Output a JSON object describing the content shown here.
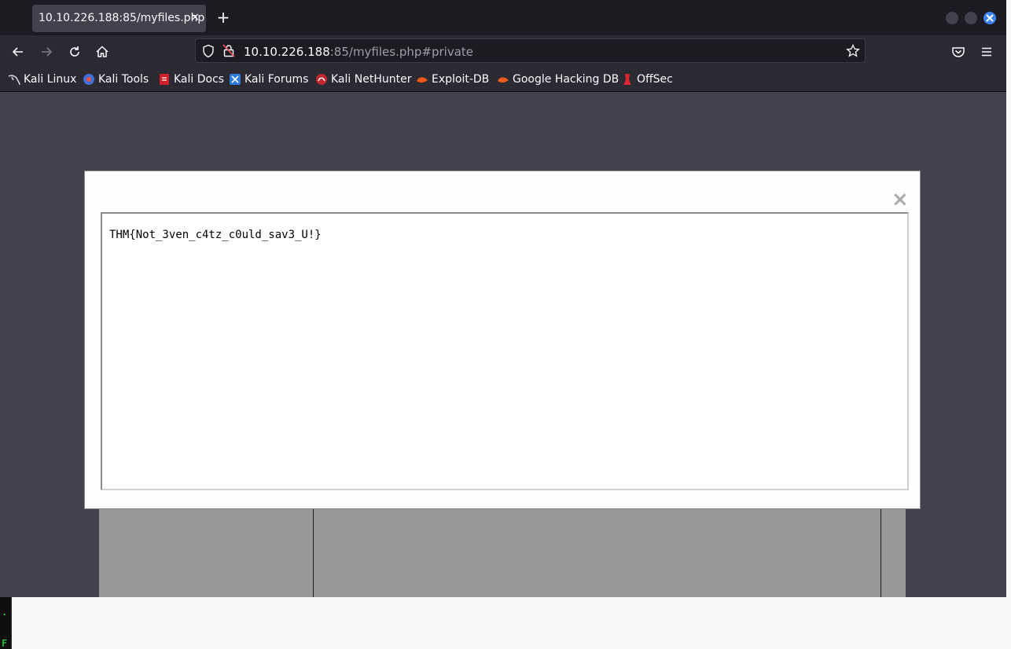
{
  "browser": {
    "tab": {
      "title": "10.10.226.188:85/myfiles.php",
      "close_glyph": "×"
    },
    "new_tab_glyph": "+",
    "url": {
      "host": "10.10.226.188",
      "rest": ":85/myfiles.php#private"
    }
  },
  "bookmarks": [
    {
      "label": "Kali Linux",
      "icon": "kali-dragon-icon"
    },
    {
      "label": "Kali Tools",
      "icon": "kali-tools-icon"
    },
    {
      "label": "Kali Docs",
      "icon": "kali-docs-icon"
    },
    {
      "label": "Kali Forums",
      "icon": "kali-forums-icon"
    },
    {
      "label": "Kali NetHunter",
      "icon": "nethunter-icon"
    },
    {
      "label": "Exploit-DB",
      "icon": "exploit-db-icon"
    },
    {
      "label": "Google Hacking DB",
      "icon": "ghdb-icon"
    },
    {
      "label": "OffSec",
      "icon": "offsec-icon"
    }
  ],
  "modal": {
    "close_glyph": "×",
    "content": "THM{Not_3ven_c4tz_c0uld_sav3_U!}"
  },
  "desktop": {
    "terminal_chars": [
      ".",
      "F"
    ]
  },
  "colors": {
    "accent_close": "#3b82f6",
    "page_bg": "#42414d",
    "chrome": "#2b2a33"
  }
}
